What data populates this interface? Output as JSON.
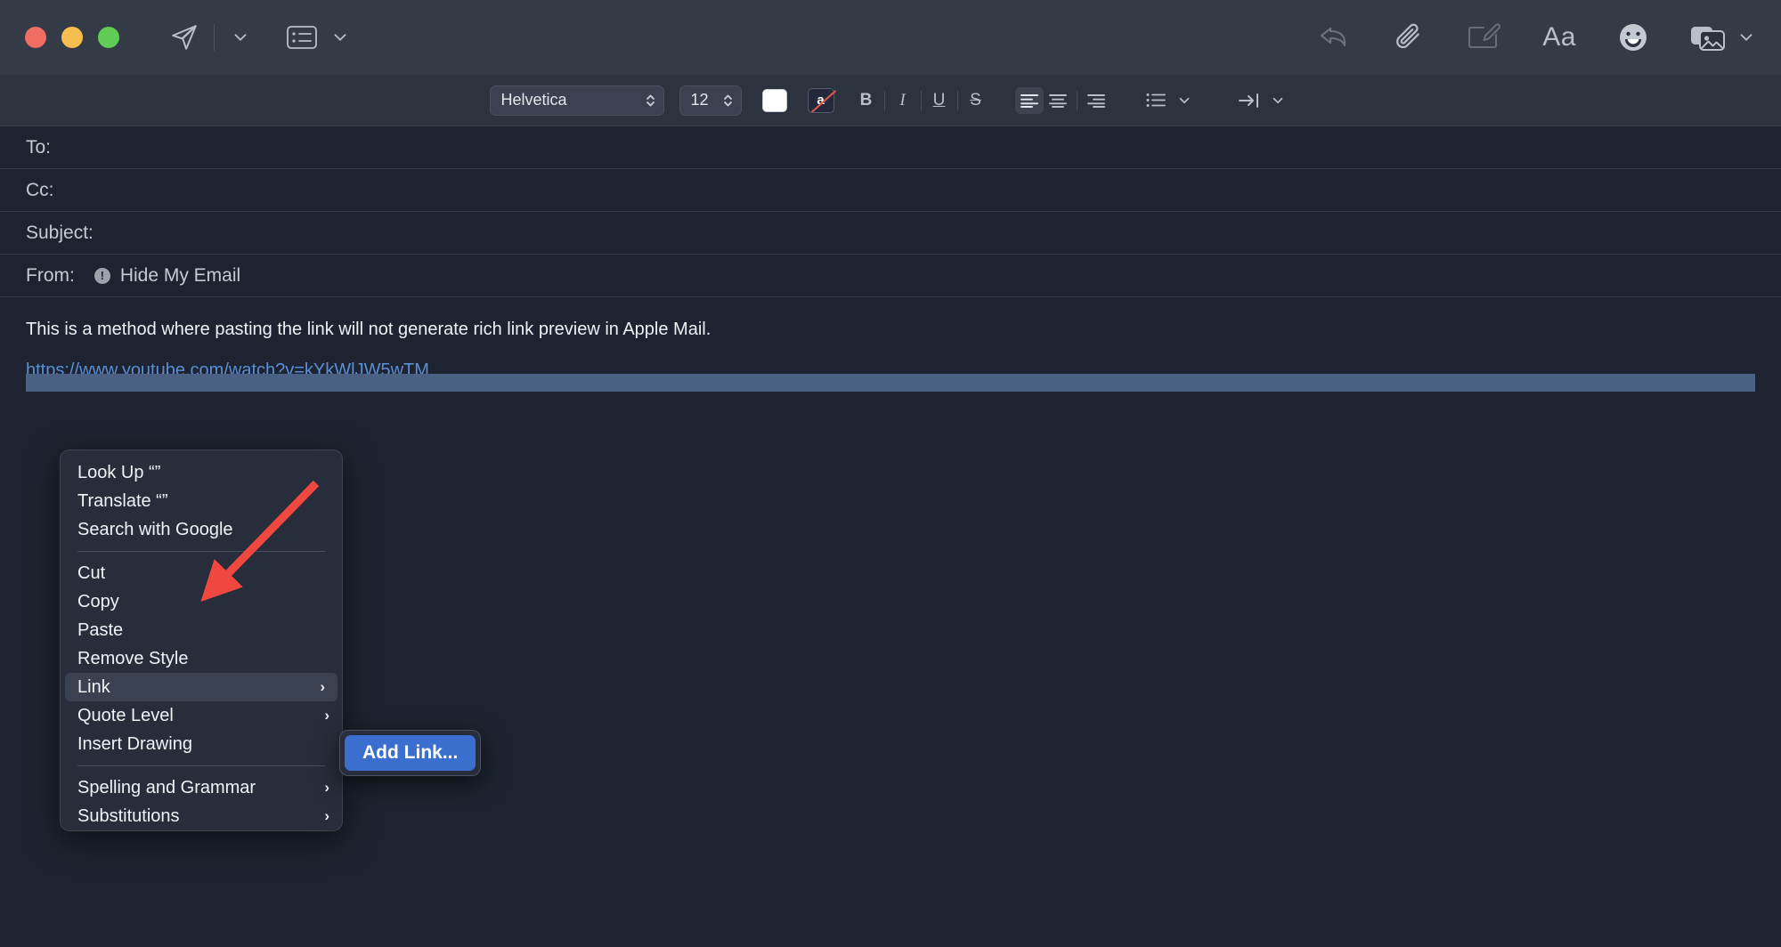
{
  "window": {
    "traffic_lights": [
      {
        "name": "close",
        "color": "#ef6d63"
      },
      {
        "name": "minimize",
        "color": "#f5be4f"
      },
      {
        "name": "zoom",
        "color": "#5fcc56"
      }
    ],
    "background": "#1d2330",
    "titlebar_background": "#343a46"
  },
  "toolbar": {
    "send_label": "Send",
    "send_menu_label": "Send Options",
    "header_fields_label": "Header Fields",
    "header_fields_menu_label": "Header Fields Options",
    "reply_label": "Reply",
    "attach_label": "Attach File",
    "markup_label": "Markup",
    "format_label": "Aa",
    "emoji_label": "Emoji & Symbols",
    "photos_label": "Photo Browser",
    "photos_menu_label": "Photo Browser Options"
  },
  "formatbar": {
    "font_family": "Helvetica",
    "font_size": "12",
    "color_swatch": "#ffffff",
    "nostyle_label": "a",
    "bold_label": "B",
    "italic_label": "I",
    "underline_label": "U",
    "strikethrough_label": "S",
    "align_left_label": "Align Left",
    "align_center_label": "Align Center",
    "align_right_label": "Align Right",
    "list_label": "Lists",
    "indent_label": "Indent"
  },
  "compose": {
    "to_label": "To:",
    "to_value": "",
    "cc_label": "Cc:",
    "cc_value": "",
    "subject_label": "Subject:",
    "subject_value": "",
    "from_label": "From:",
    "from_value": "Hide My Email",
    "from_warning_glyph": "!",
    "body_text": "This is a method where pasting the link will not generate rich link preview in Apple Mail.",
    "body_link": "https://www.youtube.com/watch?v=kYkWlJW5wTM",
    "selection_color": "#4a6184",
    "link_color": "#5b8fd6"
  },
  "context_menu": {
    "groups": [
      {
        "items": [
          {
            "label": "Look Up “”",
            "submenu": false,
            "highlight": false
          },
          {
            "label": "Translate “”",
            "submenu": false,
            "highlight": false
          },
          {
            "label": "Search with Google",
            "submenu": false,
            "highlight": false
          }
        ]
      },
      {
        "items": [
          {
            "label": "Cut",
            "submenu": false,
            "highlight": false
          },
          {
            "label": "Copy",
            "submenu": false,
            "highlight": false
          },
          {
            "label": "Paste",
            "submenu": false,
            "highlight": false
          },
          {
            "label": "Remove Style",
            "submenu": false,
            "highlight": false
          },
          {
            "label": "Link",
            "submenu": true,
            "highlight": true
          },
          {
            "label": "Quote Level",
            "submenu": true,
            "highlight": false
          },
          {
            "label": "Insert Drawing",
            "submenu": false,
            "highlight": false
          }
        ]
      },
      {
        "items": [
          {
            "label": "Spelling and Grammar",
            "submenu": true,
            "highlight": false
          },
          {
            "label": "Substitutions",
            "submenu": true,
            "highlight": false
          }
        ]
      }
    ],
    "submenu_arrow": "›",
    "highlight_color": "#3a4150"
  },
  "submenu": {
    "items": [
      {
        "label": "Add Link...",
        "selected": true
      }
    ],
    "selected_color": "#3a6fd0"
  },
  "annotation": {
    "arrow_color": "#f0483f",
    "description": "red arrow pointing at Link menu item"
  }
}
